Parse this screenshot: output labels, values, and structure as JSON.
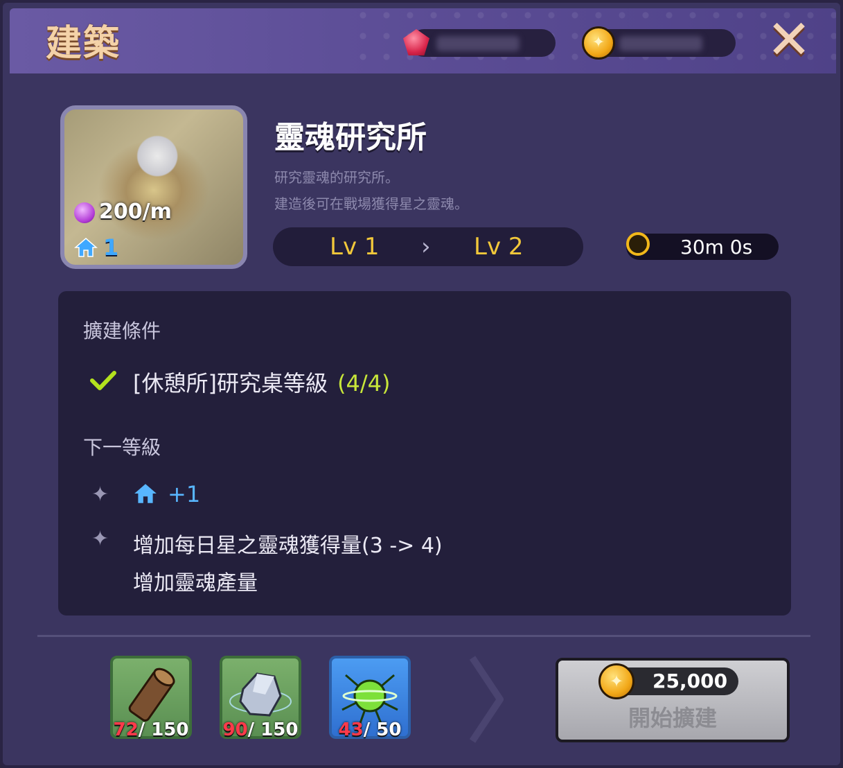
{
  "header": {
    "title": "建築",
    "close_icon": "close-icon"
  },
  "building": {
    "name": "靈魂研究所",
    "desc_line1": "研究靈魂的研究所。",
    "desc_line2": "建造後可在戰場獲得星之靈魂。",
    "production": "200/m",
    "house_count": "1",
    "level_from": "Lv 1",
    "level_arrow": "›",
    "level_to": "Lv 2",
    "duration": "30m 0s"
  },
  "requirements": {
    "title": "擴建條件",
    "items": [
      {
        "text": "[休憩所]研究桌等級",
        "count": "(4/4)"
      }
    ]
  },
  "next_level": {
    "title": "下一等級",
    "house_bonus": "+1",
    "line1": "增加每日星之靈魂獲得量(3 -> 4)",
    "line2": "增加靈魂產量"
  },
  "materials": [
    {
      "icon": "log-icon",
      "have": "72",
      "need": "/ 150"
    },
    {
      "icon": "ore-icon",
      "have": "90",
      "need": "/ 150"
    },
    {
      "icon": "green-orb-icon",
      "have": "43",
      "need": "/ 50"
    }
  ],
  "build_button": {
    "cost": "25,000",
    "label": "開始擴建"
  },
  "colors": {
    "accent_gold": "#f2c83a",
    "requirement_met": "#c8e63a",
    "insufficient": "#ff3a4a",
    "house_blue": "#58b6ff"
  }
}
